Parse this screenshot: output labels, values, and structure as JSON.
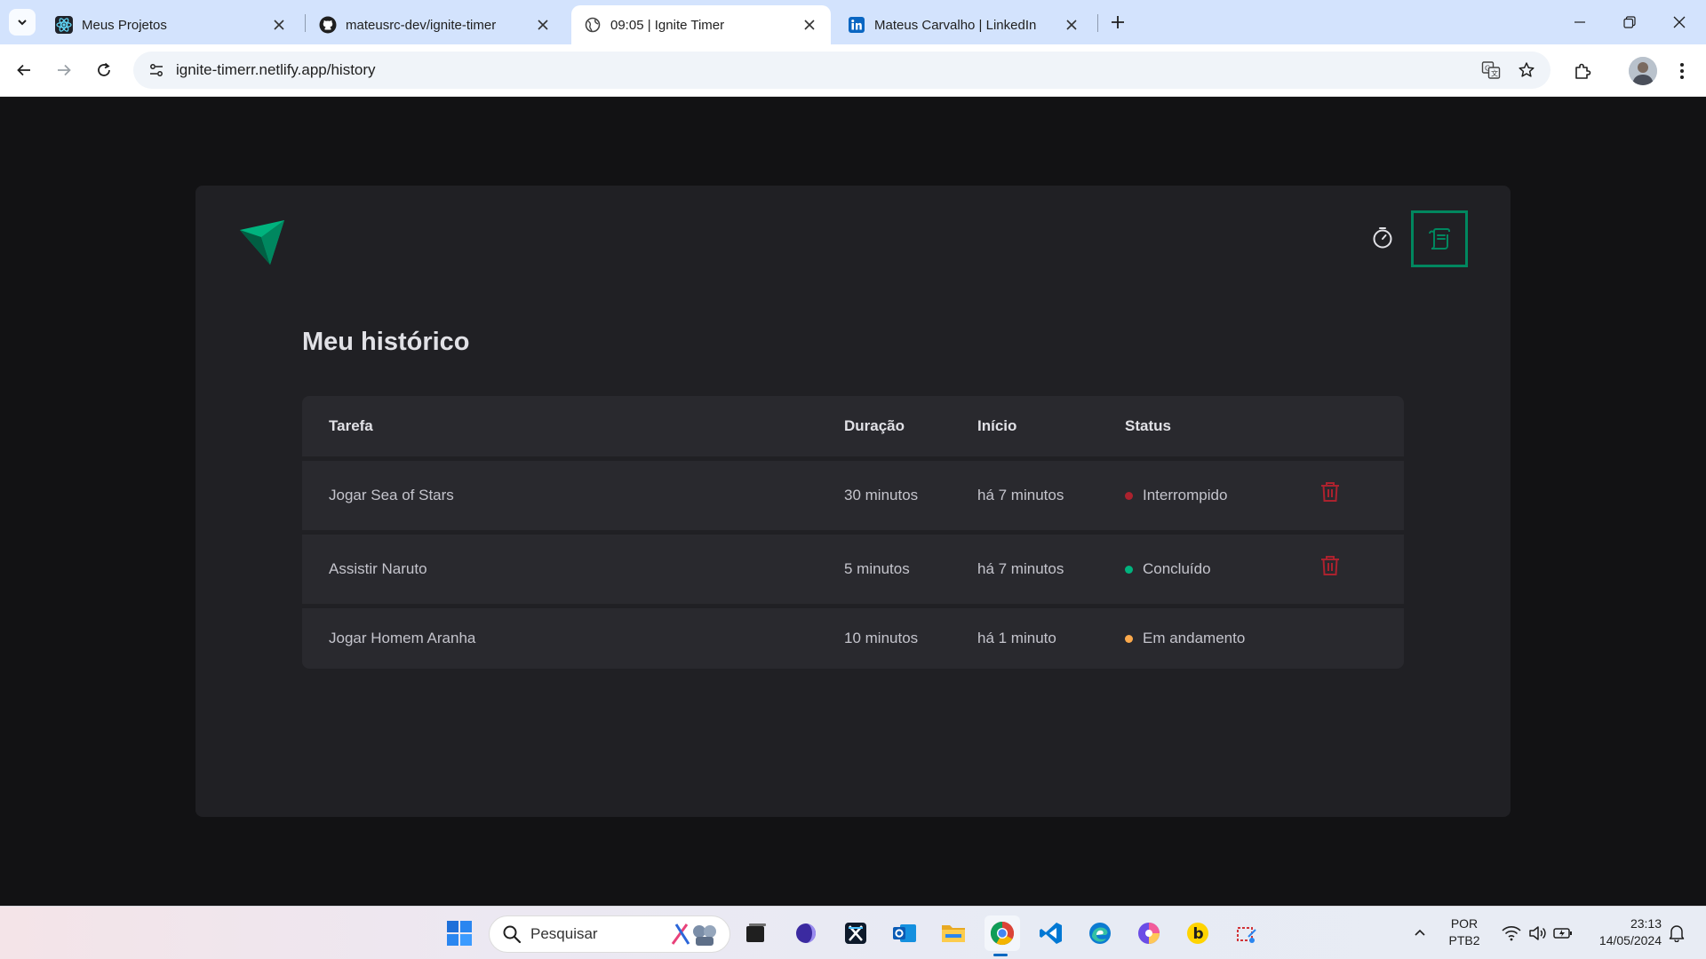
{
  "browser": {
    "tabs": [
      {
        "title": "Meus Projetos",
        "icon": "react-icon",
        "active": false
      },
      {
        "title": "mateusrc-dev/ignite-timer",
        "icon": "github-icon",
        "active": false
      },
      {
        "title": "09:05 | Ignite Timer",
        "icon": "globe-icon",
        "active": true
      },
      {
        "title": "Mateus Carvalho | LinkedIn",
        "icon": "linkedin-icon",
        "active": false
      }
    ],
    "url": "ignite-timerr.netlify.app/history"
  },
  "app": {
    "title": "Meu histórico",
    "nav": {
      "active": "history"
    },
    "table": {
      "headers": {
        "task": "Tarefa",
        "duration": "Duração",
        "start": "Início",
        "status": "Status"
      },
      "rows": [
        {
          "task": "Jogar Sea of Stars",
          "duration": "30 minutos",
          "start": "há 7 minutos",
          "status": "Interrompido",
          "status_color": "#ab222e",
          "deletable": true
        },
        {
          "task": "Assistir Naruto",
          "duration": "5 minutos",
          "start": "há 7 minutos",
          "status": "Concluído",
          "status_color": "#00b37e",
          "deletable": true
        },
        {
          "task": "Jogar Homem Aranha",
          "duration": "10 minutos",
          "start": "há 1 minuto",
          "status": "Em andamento",
          "status_color": "#fba94c",
          "deletable": false
        }
      ]
    },
    "colors": {
      "accent": "#00875f",
      "danger": "#ab222e",
      "background": "#121214",
      "card": "#202024"
    }
  },
  "taskbar": {
    "search_placeholder": "Pesquisar",
    "language": [
      "POR",
      "PTB2"
    ],
    "time": "23:13",
    "date": "14/05/2024"
  }
}
